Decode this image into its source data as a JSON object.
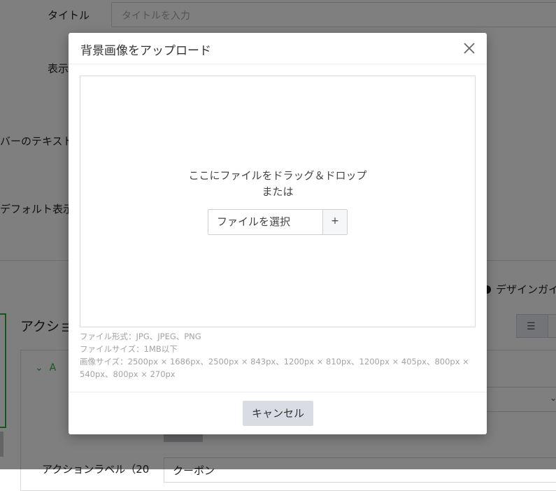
{
  "background": {
    "title_label": "タイトル",
    "title_placeholder": "タイトルを入力",
    "display_label_partial": "表示",
    "bar_text_label_partial": "バーのテキスト",
    "default_display_label_partial": "デフォルト表示",
    "action_section_title_partial": "アクショ",
    "design_radio_partial": "デザインガイ",
    "action_item_letter": "A",
    "action_label_partial": "アクションラベル（20",
    "action_label_value_partial": "クーポン"
  },
  "modal": {
    "title": "背景画像をアップロード",
    "dropzone": {
      "line1": "ここにファイルをドラッグ＆ドロップ",
      "line2": "または",
      "select_label": "ファイルを選択",
      "add_label": "+"
    },
    "notes": {
      "format": "ファイル形式：JPG、JPEG、PNG",
      "size": "ファイルサイズ：1MB以下",
      "dimensions": "画像サイズ：2500px × 1686px、2500px × 843px、1200px × 810px、1200px × 405px、800px × 540px、800px × 270px"
    },
    "cancel_label": "キャンセル"
  },
  "colors": {
    "accent_green": "#2fae3e",
    "overlay": "rgba(0,0,0,0.5)",
    "cancel_bg": "#d9dde3"
  }
}
